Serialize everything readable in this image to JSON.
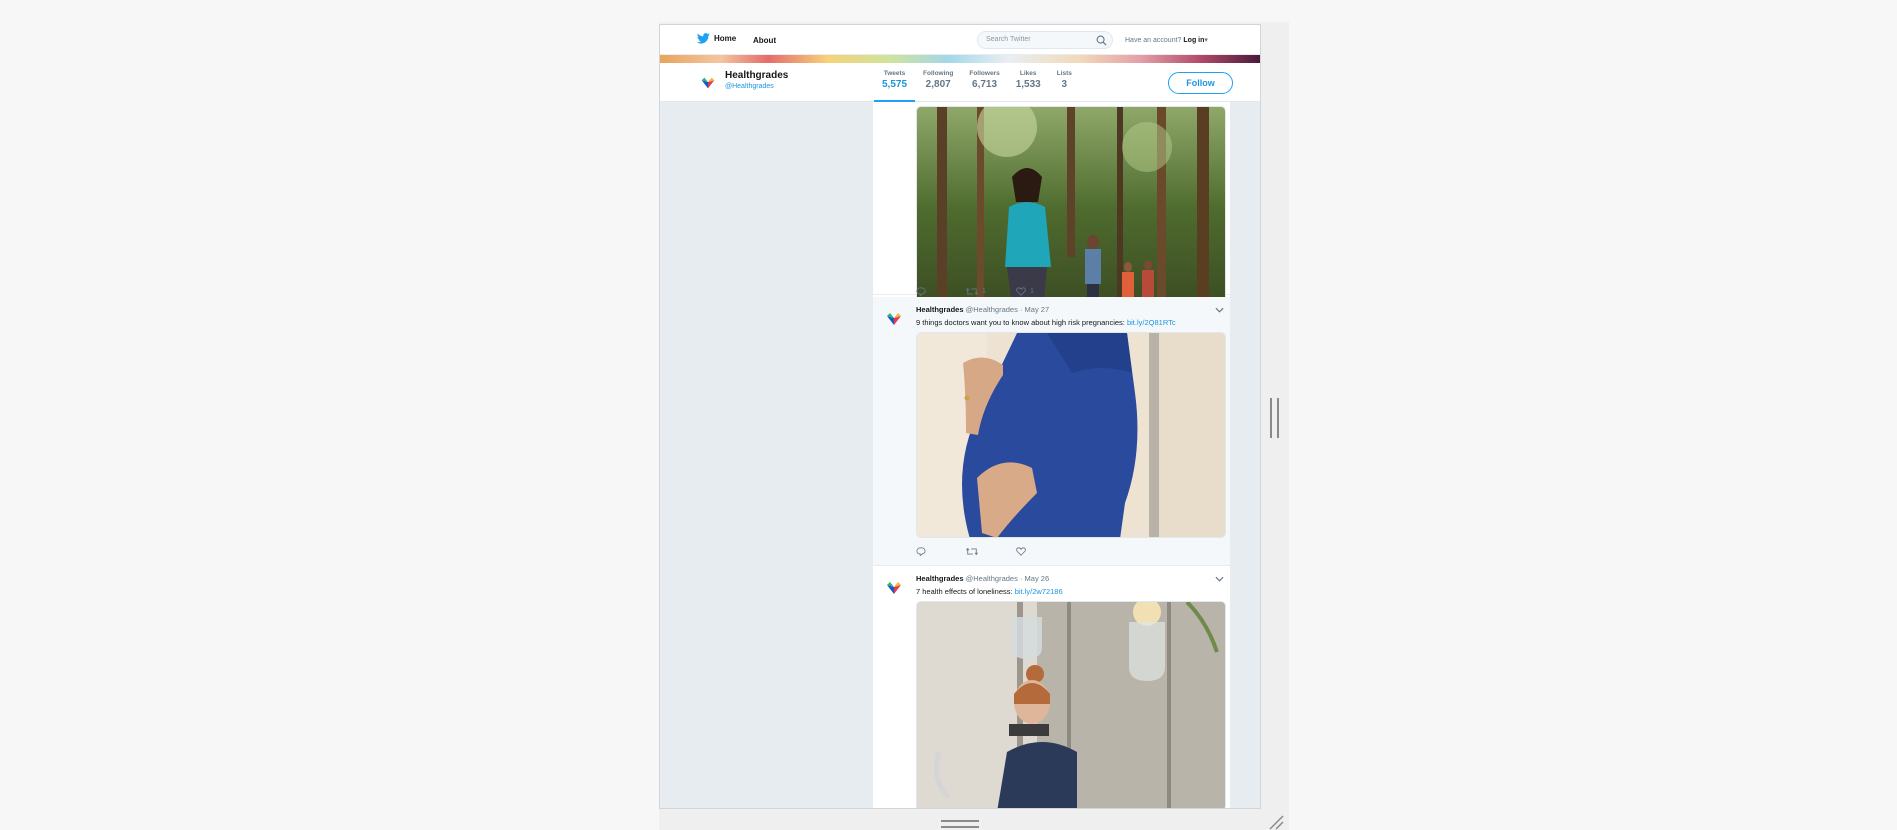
{
  "nav": {
    "home_label": "Home",
    "about_label": "About",
    "search_placeholder": "Search Twitter",
    "account_prompt": "Have an account?",
    "login_label": "Log in"
  },
  "profile": {
    "name": "Healthgrades",
    "handle": "@Healthgrades",
    "follow_label": "Follow",
    "stats": [
      {
        "label": "Tweets",
        "value": "5,575"
      },
      {
        "label": "Following",
        "value": "2,807"
      },
      {
        "label": "Followers",
        "value": "6,713"
      },
      {
        "label": "Likes",
        "value": "1,533"
      },
      {
        "label": "Lists",
        "value": "3"
      }
    ]
  },
  "tweets": [
    {
      "image": "woman-hiking-forest-photo",
      "retweets": "1",
      "likes": "1"
    },
    {
      "name": "Healthgrades",
      "handle": "@Healthgrades",
      "date": "· May 27",
      "text": "9 things doctors want you to know about high risk pregnancies:",
      "link": "bit.ly/2Q81RTc",
      "image": "pregnant-woman-blue-dress-photo",
      "retweets": "",
      "likes": ""
    },
    {
      "name": "Healthgrades",
      "handle": "@Healthgrades",
      "date": "· May 26",
      "text": "7 health effects of loneliness:",
      "link": "bit.ly/2w72186",
      "image": "woman-looking-out-window-photo"
    }
  ],
  "colors": {
    "accent": "#1da1f2",
    "link": "#1b95e0",
    "page_bg": "#e6ecf0"
  }
}
